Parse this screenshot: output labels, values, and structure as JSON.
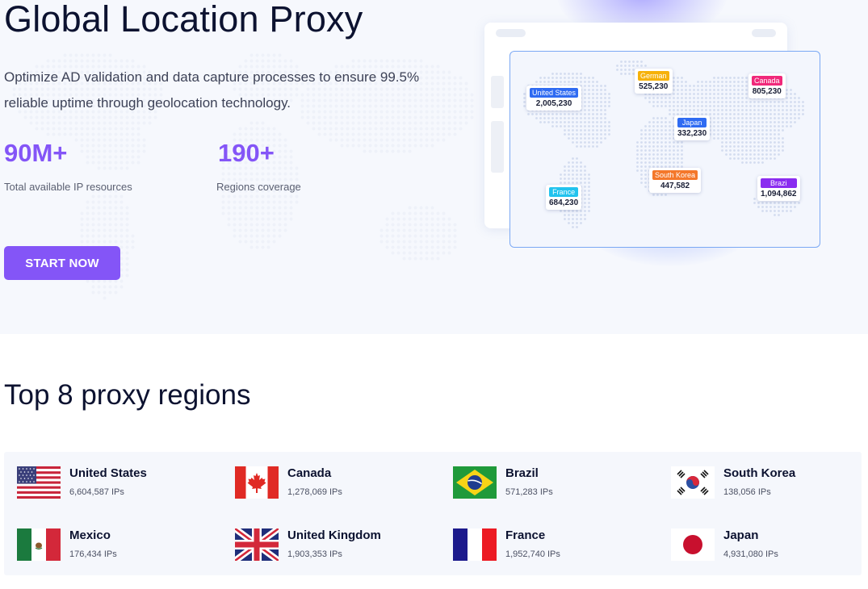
{
  "hero": {
    "title": "Global Location Proxy",
    "description": "Optimize AD validation and data capture processes to ensure 99.5% reliable uptime through geolocation technology.",
    "stats": [
      {
        "value": "90M+",
        "label": "Total available IP resources"
      },
      {
        "value": "190+",
        "label": "Regions coverage"
      }
    ],
    "cta_label": "START NOW"
  },
  "map": {
    "tags": [
      {
        "name": "United States",
        "count": "2,005,230",
        "color": "#2f6bf2"
      },
      {
        "name": "German",
        "count": "525,230",
        "color": "#f6b10a"
      },
      {
        "name": "Canada",
        "count": "805,230",
        "color": "#f0287a"
      },
      {
        "name": "Japan",
        "count": "332,230",
        "color": "#2f6bf2"
      },
      {
        "name": "France",
        "count": "684,230",
        "color": "#22c3ee"
      },
      {
        "name": "South Korea",
        "count": "447,582",
        "color": "#f4782b"
      },
      {
        "name": "Brazi",
        "count": "1,094,862",
        "color": "#8a2cf0"
      }
    ]
  },
  "regions_section": {
    "title": "Top 8 proxy regions",
    "regions": [
      {
        "name": "United States",
        "ips": "6,604,587 IPs",
        "flag": "us-flag-icon"
      },
      {
        "name": "Canada",
        "ips": "1,278,069 IPs",
        "flag": "canada-flag-icon"
      },
      {
        "name": "Brazil",
        "ips": "571,283 IPs",
        "flag": "brazil-flag-icon"
      },
      {
        "name": "South Korea",
        "ips": "138,056 IPs",
        "flag": "south-korea-flag-icon"
      },
      {
        "name": "Mexico",
        "ips": "176,434 IPs",
        "flag": "mexico-flag-icon"
      },
      {
        "name": "United Kingdom",
        "ips": "1,903,353 IPs",
        "flag": "uk-flag-icon"
      },
      {
        "name": "France",
        "ips": "1,952,740 IPs",
        "flag": "france-flag-icon"
      },
      {
        "name": "Japan",
        "ips": "4,931,080 IPs",
        "flag": "japan-flag-icon"
      }
    ]
  },
  "colors": {
    "accent": "#8455f7",
    "text": "#0c1230",
    "hero_bg": "#f6f8fd",
    "map_border": "#7aa8f4"
  }
}
